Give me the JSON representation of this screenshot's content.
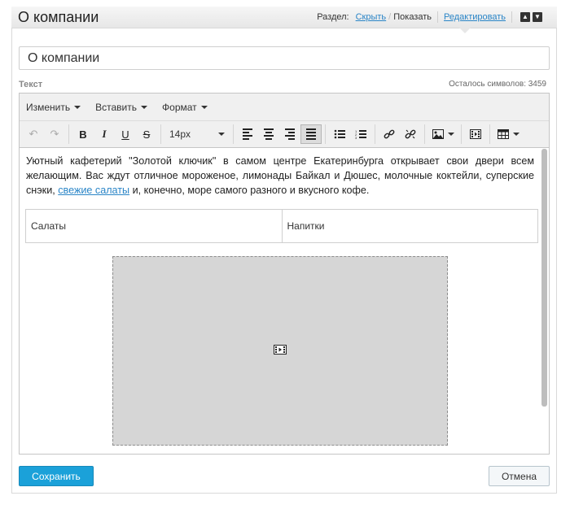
{
  "header": {
    "title": "О компании",
    "section_label": "Раздел:",
    "hide_link": "Скрыть",
    "show_label": "Показать",
    "edit_link": "Редактировать"
  },
  "form": {
    "title_value": "О компании",
    "text_label": "Текст",
    "chars_left": "Осталось символов: 3459"
  },
  "editor": {
    "menu": [
      "Изменить",
      "Вставить",
      "Формат"
    ],
    "font_size": "14px",
    "paragraph_before_link": "Уютный кафетерий \"Золотой ключик\" в самом центре Екатеринбурга открывает свои двери всем желающим. Вас ждут отличное мороженое, лимонады Байкал и Дюшес, молочные коктейли, суперские снэки, ",
    "paragraph_link": "свежие салаты",
    "paragraph_after_link": " и, конечно, море самого разного и вкусного кофе.",
    "table": [
      "Салаты",
      "Напитки"
    ]
  },
  "actions": {
    "save": "Сохранить",
    "cancel": "Отмена"
  },
  "colors": {
    "accent": "#1ba1d9",
    "link": "#2a85c7"
  }
}
